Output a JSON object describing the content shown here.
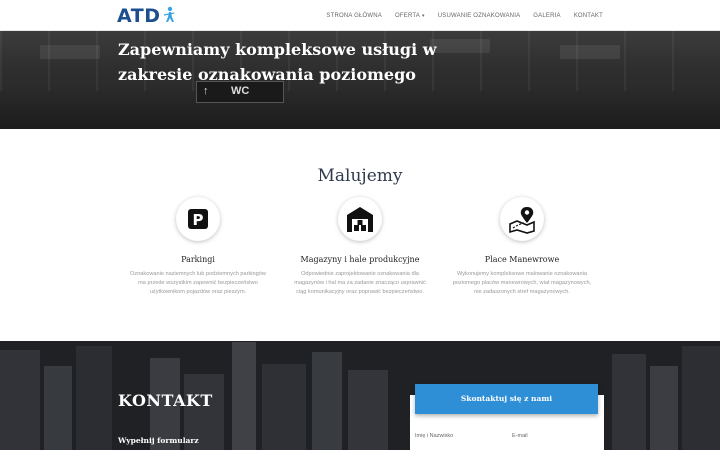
{
  "brand": {
    "logo_text": "ATD"
  },
  "nav": {
    "items": [
      {
        "label": "STRONA GŁÓWNA"
      },
      {
        "label": "OFERTA",
        "caret": "▾"
      },
      {
        "label": "USUWANIE OZNAKOWANIA"
      },
      {
        "label": "GALERIA"
      },
      {
        "label": "KONTAKT"
      }
    ]
  },
  "hero": {
    "headline": "Zapewniamy kompleksowe usługi w zakresie oznakowania poziomego",
    "sign_arrow": "↑",
    "sign_text": "WC"
  },
  "services": {
    "heading": "Malujemy",
    "items": [
      {
        "icon": "parking-icon",
        "glyph": "P",
        "title": "Parkingi",
        "text": "Oznakowanie naziemnych lub podziemnych parkingów ma przede wszystkim zapewnić bezpieczeństwo użytkownikom pojazdów oraz pieszym."
      },
      {
        "icon": "warehouse-icon",
        "title": "Magazyny i hale produkcyjne",
        "text": "Odpowiednie zaprojektowanie oznakowania dla magazynów i hal ma za zadanie znacząco usprawnić ciąg komunikacyjny oraz poprawić bezpieczeństwo."
      },
      {
        "icon": "map-pin-icon",
        "title": "Place Manewrowe",
        "text": "Wykonujemy kompleksowe malowanie oznakowania poziomego placów manewrowych, wiat magazynowych, nie zadaszonych stref magazynowych."
      }
    ]
  },
  "contact": {
    "heading": "KONTAKT",
    "subheading": "Wypełnij formularz",
    "button_label": "Skontaktuj się z nami",
    "fields": {
      "name_label": "Imię i Nazwisko",
      "email_label": "E-mail"
    }
  },
  "colors": {
    "brand": "#1d4e8f",
    "accent": "#2e8fd6",
    "heading": "#2f3a4c"
  }
}
